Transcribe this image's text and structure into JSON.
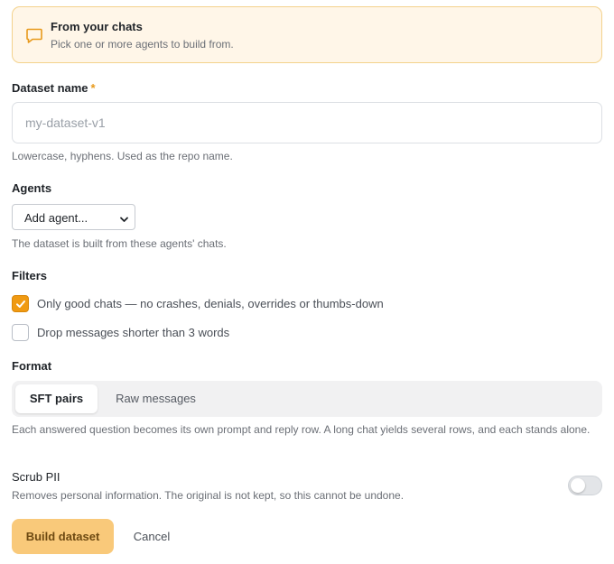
{
  "banner": {
    "title": "From your chats",
    "subtitle": "Pick one or more agents to build from.",
    "icon": "chat-bubble-icon",
    "accent": "#e89a1c"
  },
  "dataset_name": {
    "label": "Dataset name",
    "required_mark": "*",
    "value": "",
    "placeholder": "my-dataset-v1",
    "help": "Lowercase, hyphens. Used as the repo name."
  },
  "agents": {
    "label": "Agents",
    "select_value": "Add agent...",
    "help": "The dataset is built from these agents' chats."
  },
  "filters": {
    "label": "Filters",
    "items": [
      {
        "label": "Only good chats — no crashes, denials, overrides or thumbs-down",
        "checked": true
      },
      {
        "label": "Drop messages shorter than 3 words",
        "checked": false
      }
    ]
  },
  "format": {
    "label": "Format",
    "options": [
      "SFT pairs",
      "Raw messages"
    ],
    "selected": "SFT pairs",
    "help": "Each answered question becomes its own prompt and reply row. A long chat yields several rows, and each stands alone."
  },
  "scrub_pii": {
    "label": "Scrub PII",
    "help": "Removes personal information. The original is not kept, so this cannot be undone.",
    "enabled": false
  },
  "actions": {
    "build_label": "Build dataset",
    "cancel_label": "Cancel"
  },
  "colors": {
    "accent": "#f09a12",
    "banner_bg": "#fff6e8",
    "primary_button": "#f9c97a"
  }
}
